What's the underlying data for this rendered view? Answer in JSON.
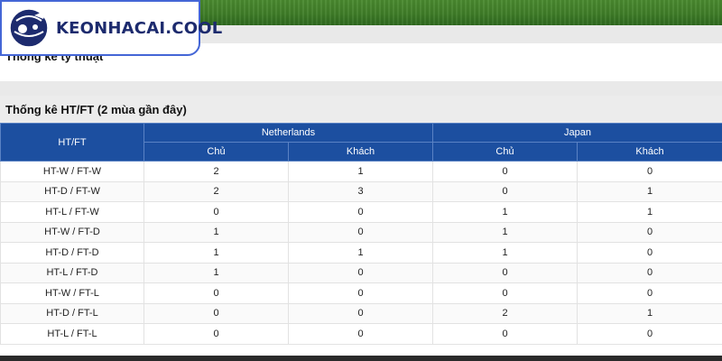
{
  "logo": {
    "text": "KEONHACAI.COOL"
  },
  "colors": {
    "header_blue": "#1c4fa0",
    "grass_green": "#3f7d28",
    "logo_border": "#4466d6"
  },
  "tech_section": {
    "title": "Thống kê tỷ thuật"
  },
  "htft_section": {
    "title": "Thống kê HT/FT (2 mùa gần đây)",
    "row_header": "HT/FT",
    "teams": [
      "Netherlands",
      "Japan"
    ],
    "sub_headers": [
      "Chủ",
      "Khách",
      "Chủ",
      "Khách"
    ],
    "rows": [
      {
        "label": "HT-W / FT-W",
        "values": [
          "2",
          "1",
          "0",
          "0"
        ]
      },
      {
        "label": "HT-D / FT-W",
        "values": [
          "2",
          "3",
          "0",
          "1"
        ]
      },
      {
        "label": "HT-L / FT-W",
        "values": [
          "0",
          "0",
          "1",
          "1"
        ]
      },
      {
        "label": "HT-W / FT-D",
        "values": [
          "1",
          "0",
          "1",
          "0"
        ]
      },
      {
        "label": "HT-D / FT-D",
        "values": [
          "1",
          "1",
          "1",
          "0"
        ]
      },
      {
        "label": "HT-L / FT-D",
        "values": [
          "1",
          "0",
          "0",
          "0"
        ]
      },
      {
        "label": "HT-W / FT-L",
        "values": [
          "0",
          "0",
          "0",
          "0"
        ]
      },
      {
        "label": "HT-D / FT-L",
        "values": [
          "0",
          "0",
          "2",
          "1"
        ]
      },
      {
        "label": "HT-L / FT-L",
        "values": [
          "0",
          "0",
          "0",
          "0"
        ]
      }
    ]
  }
}
